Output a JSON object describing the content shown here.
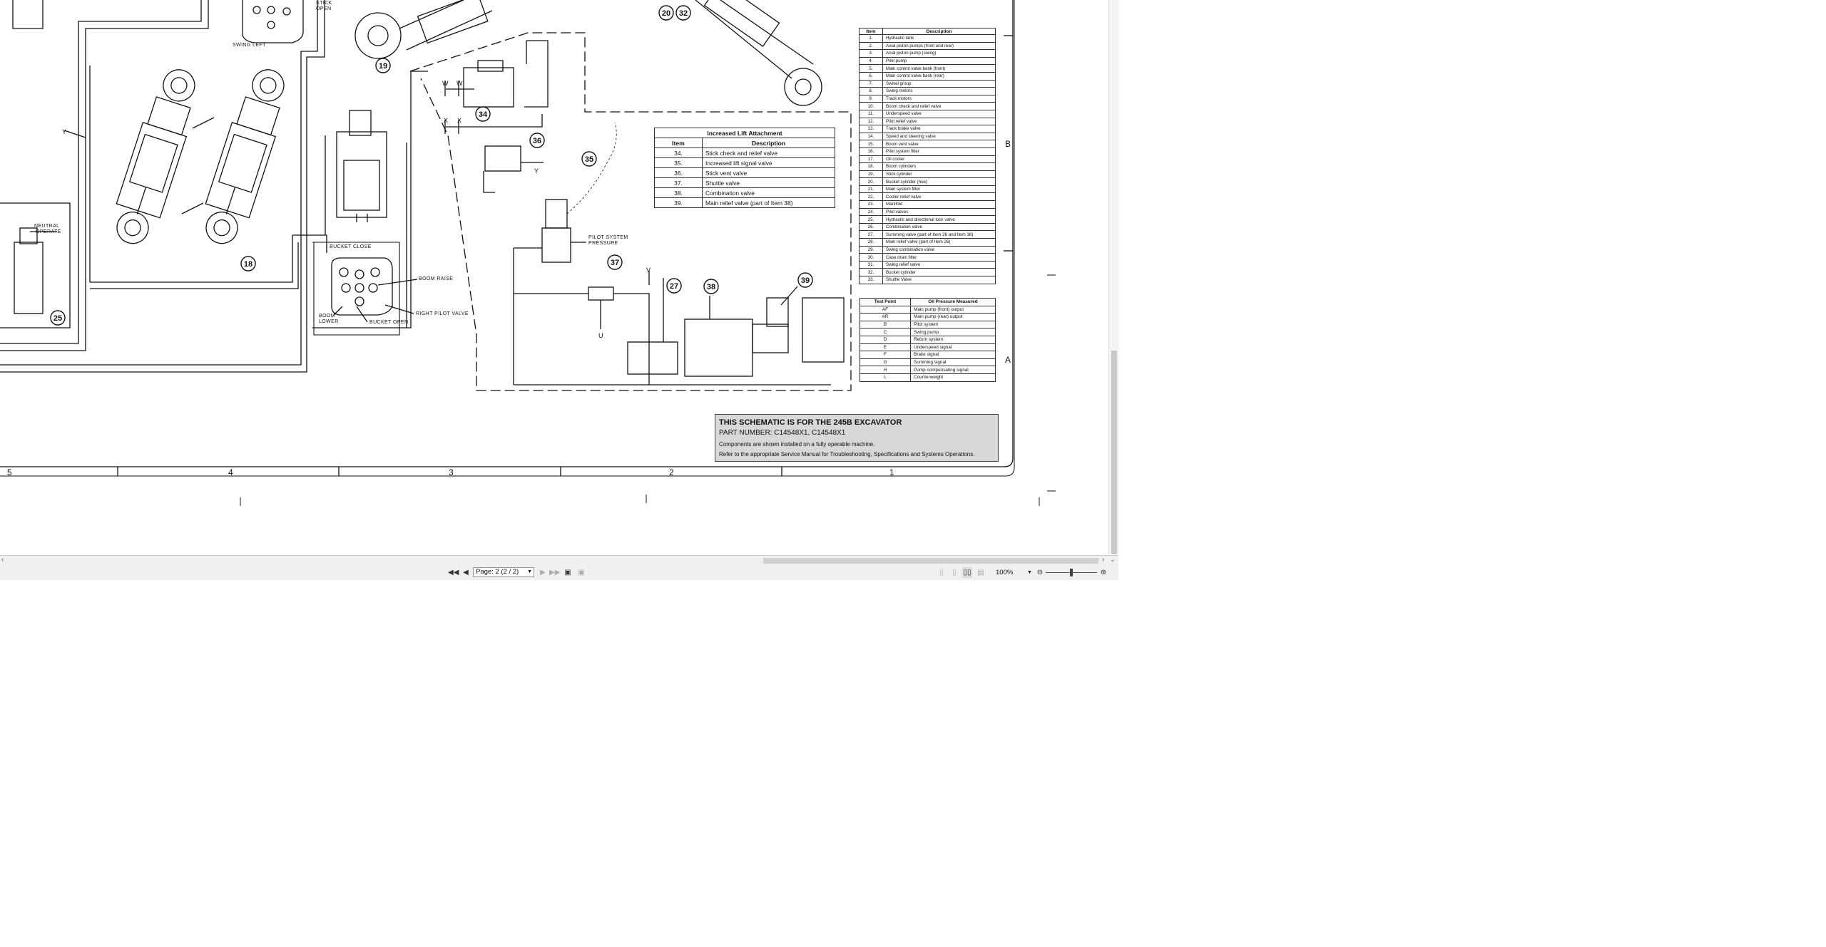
{
  "schematic": {
    "parts_table": {
      "headers": [
        "Item",
        "Description"
      ],
      "rows": [
        [
          "1.",
          "Hydraulic tank"
        ],
        [
          "2.",
          "Axial piston pumps (front and rear)"
        ],
        [
          "3.",
          "Axial piston pump (swing)"
        ],
        [
          "4.",
          "Pilot pump"
        ],
        [
          "5.",
          "Main control valve bank (front)"
        ],
        [
          "6.",
          "Main control valve bank (rear)"
        ],
        [
          "7.",
          "Swivel group"
        ],
        [
          "8.",
          "Swing motors"
        ],
        [
          "9.",
          "Track motors"
        ],
        [
          "10.",
          "Boom check and relief valve"
        ],
        [
          "11.",
          "Underspeed valve"
        ],
        [
          "12.",
          "Pilot relief valve"
        ],
        [
          "13.",
          "Track brake valve"
        ],
        [
          "14.",
          "Speed and steering valve"
        ],
        [
          "15.",
          "Boom vent valve"
        ],
        [
          "16.",
          "Pilot system filter"
        ],
        [
          "17.",
          "Oil cooler"
        ],
        [
          "18.",
          "Boom cylinders"
        ],
        [
          "19.",
          "Stick cylinder"
        ],
        [
          "20.",
          "Bucket cylinder (hoe)"
        ],
        [
          "21.",
          "Main system filter"
        ],
        [
          "22.",
          "Cooler relief valve"
        ],
        [
          "23.",
          "Manifold"
        ],
        [
          "24.",
          "Pilot valves"
        ],
        [
          "25.",
          "Hydraulic and directional lock valve"
        ],
        [
          "26.",
          "Combination valve"
        ],
        [
          "27.",
          "Summing valve (part of Item 26 and Item 38)"
        ],
        [
          "28.",
          "Main relief valve (part of Item 26)"
        ],
        [
          "29.",
          "Swing combination valve"
        ],
        [
          "30.",
          "Case drain filter"
        ],
        [
          "31.",
          "Swing relief valve"
        ],
        [
          "32.",
          "Bucket cylinder"
        ],
        [
          "33.",
          "Shuttle Valve"
        ]
      ]
    },
    "test_points_table": {
      "headers": [
        "Test Point",
        "Oil Pressure Measured"
      ],
      "rows": [
        [
          "AF",
          "Main pump (front) output"
        ],
        [
          "AR",
          "Main pump (rear) output"
        ],
        [
          "B",
          "Pilot system"
        ],
        [
          "C",
          "Swing pump"
        ],
        [
          "D",
          "Return system"
        ],
        [
          "E",
          "Underspeed signal"
        ],
        [
          "F",
          "Brake signal"
        ],
        [
          "G",
          "Summing signal"
        ],
        [
          "H",
          "Pump compensating signal"
        ],
        [
          "L",
          "Counterweight"
        ]
      ]
    },
    "lift_table": {
      "title": "Increased Lift Attachment",
      "headers": [
        "Item",
        "Description"
      ],
      "rows": [
        [
          "34.",
          "Stick check and relief valve"
        ],
        [
          "35.",
          "Increased lift signal valve"
        ],
        [
          "36.",
          "Stick vent valve"
        ],
        [
          "37.",
          "Shuttle valve"
        ],
        [
          "38.",
          "Combination valve"
        ],
        [
          "39.",
          "Main relief valve (part of Item 38)"
        ]
      ]
    },
    "note": {
      "line1": "THIS SCHEMATIC IS FOR THE 245B EXCAVATOR",
      "line2": "PART NUMBER: C14548X1, C14548X1",
      "line3": "Components are shown installed on a fully operable machine.",
      "line4": "Refer to the appropriate Service Manual for Troubleshooting, Specifications and Systems Operations."
    },
    "zone_columns": [
      "5",
      "4",
      "3",
      "2",
      "1"
    ],
    "zone_rows": [
      "B",
      "A"
    ],
    "item_callouts": [
      "20",
      "32",
      "19",
      "34",
      "36",
      "35",
      "18",
      "37",
      "27",
      "38",
      "39",
      "25"
    ],
    "port_labels": [
      "W",
      "W",
      "X",
      "X",
      "Y",
      "Y",
      "V",
      "U"
    ],
    "valve_labels": {
      "stick_open": "STICK OPEN",
      "swing_left": "SWING LEFT",
      "neutral": "NEUTRAL",
      "operate": "OPERATE",
      "bucket_close": "BUCKET CLOSE",
      "boom_raise": "BOOM RAISE",
      "boom_lower": "BOOM LOWER",
      "bucket_open": "BUCKET OPEN",
      "right_pilot_valve": "RIGHT PILOT VALVE",
      "pilot_system_pressure": "PILOT SYSTEM PRESSURE"
    }
  },
  "toolbar": {
    "page_field": "Page: 2 (2 / 2)",
    "zoom": "100%"
  },
  "icons": {
    "first_page": "first-page-icon",
    "prev_page": "previous-page-icon",
    "next_page": "next-page-icon",
    "last_page": "last-page-icon",
    "zoom_out": "zoom-out-icon",
    "zoom_in": "zoom-in-icon"
  }
}
